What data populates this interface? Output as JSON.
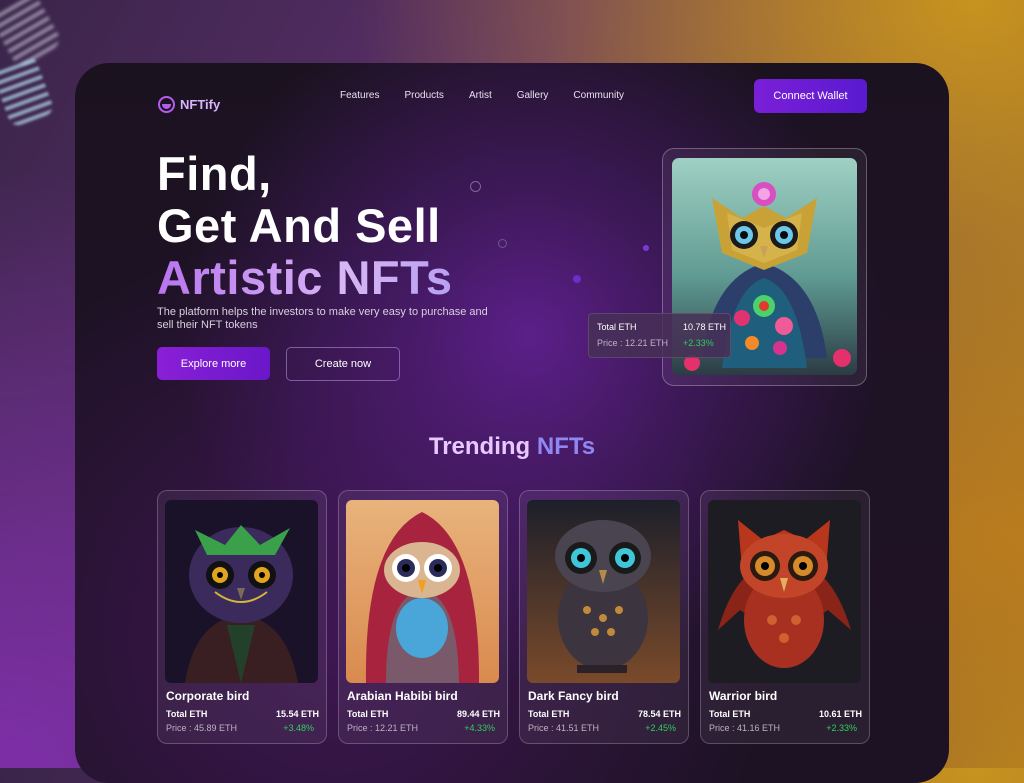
{
  "brand": {
    "name": "NFTify",
    "accent": "#b45cf0"
  },
  "nav": {
    "items": [
      "Features",
      "Products",
      "Artist",
      "Gallery",
      "Community"
    ],
    "connect_label": "Connect Wallet"
  },
  "hero": {
    "title_line1": "Find,",
    "title_line2": "Get And Sell",
    "title_line3": "Artistic NFTs",
    "description": "The platform helps the investors to make very easy to purchase and sell their NFT tokens",
    "primary_button": "Explore more",
    "secondary_button": "Create now",
    "price_card": {
      "total_label": "Total ETH",
      "total_value": "10.78 ETH",
      "price_label": "Price : 12.21 ETH",
      "change": "+2.33%"
    }
  },
  "trending": {
    "title_part1": "Trending",
    "title_part2": "NFTs",
    "cards": [
      {
        "name": "Corporate bird",
        "total_label": "Total ETH",
        "total_value": "15.54 ETH",
        "price_label": "Price : 45.89 ETH",
        "change": "+3.48%"
      },
      {
        "name": "Arabian Habibi bird",
        "total_label": "Total ETH",
        "total_value": "89.44 ETH",
        "price_label": "Price : 12.21 ETH",
        "change": "+4.33%"
      },
      {
        "name": "Dark Fancy bird",
        "total_label": "Total ETH",
        "total_value": "78.54 ETH",
        "price_label": "Price : 41.51 ETH",
        "change": "+2.45%"
      },
      {
        "name": "Warrior bird",
        "total_label": "Total ETH",
        "total_value": "10.61 ETH",
        "price_label": "Price : 41.16 ETH",
        "change": "+2.33%"
      }
    ]
  },
  "colors": {
    "positive": "#2ecf5b",
    "button": "#7a1fd8"
  }
}
